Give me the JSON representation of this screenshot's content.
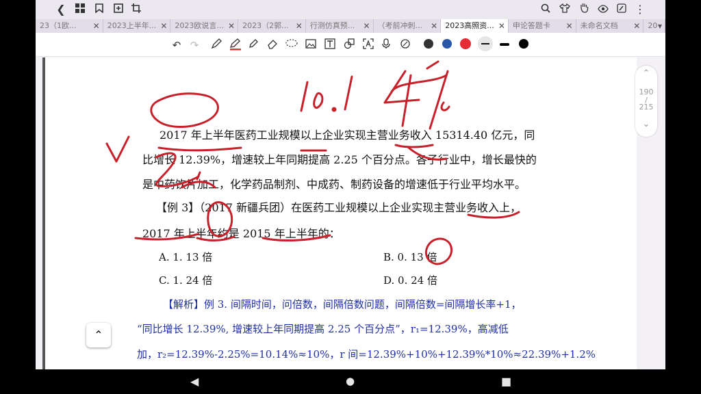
{
  "topbar": {
    "back_icon": "chevron-left-icon",
    "right_icons": [
      "search-icon",
      "shirt-icon",
      "hand-icon",
      "eye-icon",
      "pen-tablet-icon",
      "more-vert-icon"
    ]
  },
  "tabs": [
    {
      "label": "23（1欧..."
    },
    {
      "label": "2023上半年..."
    },
    {
      "label": "2023欧说言..."
    },
    {
      "label": "2023（2郭..."
    },
    {
      "label": "行测仿真预..."
    },
    {
      "label": "（考前冲刺..."
    },
    {
      "label": "2023高照资...",
      "active": true
    },
    {
      "label": "申论答题卡"
    },
    {
      "label": "未命名文档"
    },
    {
      "label": "20"
    }
  ],
  "toolbar": {
    "colors": [
      "#333333",
      "#2a56a8",
      "#e52b36",
      "#111111",
      "#000000",
      "#000000"
    ]
  },
  "doc": {
    "line1": "2017 年上半年医药工业规模以上企业实现主营业务收入 15314.40 亿元，同",
    "line2": "比增长 12.39%，增速较上年同期提高 2.25 个百分点。各子行业中，增长最快的",
    "line3": "是中药饮片加工，化学药品制剂、中成药、制药设备的增速低于行业平均水平。",
    "line4": "【例 3】（2017 新疆兵团）在医药工业规模以上企业实现主营业务收入上，",
    "line5": "2017 年上半年约是 2015 年上半年的：",
    "optA": "A. 1. 13 倍",
    "optB": "B. 0. 13 倍",
    "optC": "C. 1. 24 倍",
    "optD": "D. 0. 24 倍",
    "ana1": "【解析】例 3. 间隔时间，问倍数，间隔倍数问题，间隔倍数=间隔增长率+1，",
    "ana2": "“同比增长  12.39%, 增速较上年同期提高  2.25  个百分点”，r₁=12.39%，高减低",
    "ana3": "加，r₂=12.39%-2.25%=10.14%≈10%，r 间=12.39%+10%+12.39%*10%≈22.39%+1.2%"
  },
  "scroll": {
    "current": "190",
    "total": "215"
  }
}
